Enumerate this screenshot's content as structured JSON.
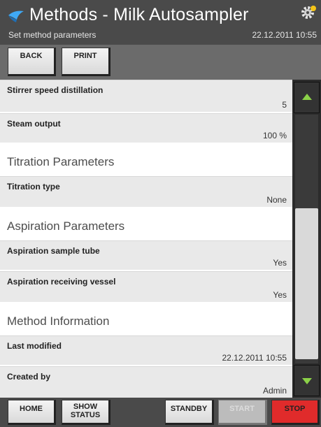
{
  "header": {
    "title": "Methods - Milk Autosampler",
    "subtitle": "Set method parameters",
    "datetime": "22.12.2011 10:55"
  },
  "toolbar": {
    "back_label": "BACK",
    "print_label": "PRINT"
  },
  "rows": [
    {
      "label": "Stirrer speed distillation",
      "value": "5"
    },
    {
      "label": "Steam output",
      "value": "100 %"
    },
    {
      "label": "Titration type",
      "value": "None"
    },
    {
      "label": "Aspiration sample tube",
      "value": "Yes"
    },
    {
      "label": "Aspiration receiving vessel",
      "value": "Yes"
    },
    {
      "label": "Last modified",
      "value": "22.12.2011 10:55"
    },
    {
      "label": "Created by",
      "value": "Admin"
    }
  ],
  "sections": {
    "titration": "Titration Parameters",
    "aspiration": "Aspiration Parameters",
    "method_info": "Method Information"
  },
  "footer": {
    "home_label": "HOME",
    "show_status_line1": "SHOW",
    "show_status_line2": "STATUS",
    "standby_label": "STANDBY",
    "start_label": "START",
    "stop_label": "STOP"
  },
  "colors": {
    "header_bg": "#4a4a4a",
    "accent_green": "#8bd148",
    "stop_red": "#e02b2b",
    "row_bg": "#e9e9e9"
  },
  "icons": {
    "app": "methods-icon",
    "settings": "gear-icon",
    "scroll_up": "arrow-up-icon",
    "scroll_down": "arrow-down-icon"
  }
}
